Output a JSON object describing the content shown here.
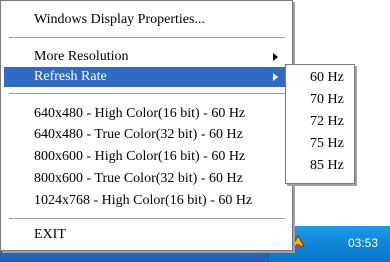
{
  "menu": {
    "items": [
      {
        "label": "Windows Display Properties..."
      },
      {
        "label": "More Resolution"
      },
      {
        "label": "Refresh Rate"
      },
      {
        "label": "640x480 - High Color(16 bit) - 60 Hz"
      },
      {
        "label": "640x480 - True Color(32 bit) - 60 Hz"
      },
      {
        "label": "800x600 - High Color(16 bit) - 60 Hz"
      },
      {
        "label": "800x600 - True Color(32 bit) - 60 Hz"
      },
      {
        "label": "1024x768 - High Color(16 bit) - 60 Hz"
      },
      {
        "label": "EXIT"
      }
    ]
  },
  "submenu": {
    "items": [
      {
        "label": "60 Hz"
      },
      {
        "label": "70 Hz"
      },
      {
        "label": "72 Hz"
      },
      {
        "label": "75 Hz"
      },
      {
        "label": "85 Hz"
      }
    ]
  },
  "taskbar": {
    "clock": "03:53"
  },
  "colors": {
    "selection": "#316ac5",
    "taskbar": "#2a6fc8",
    "tray": "#0f86d8"
  }
}
